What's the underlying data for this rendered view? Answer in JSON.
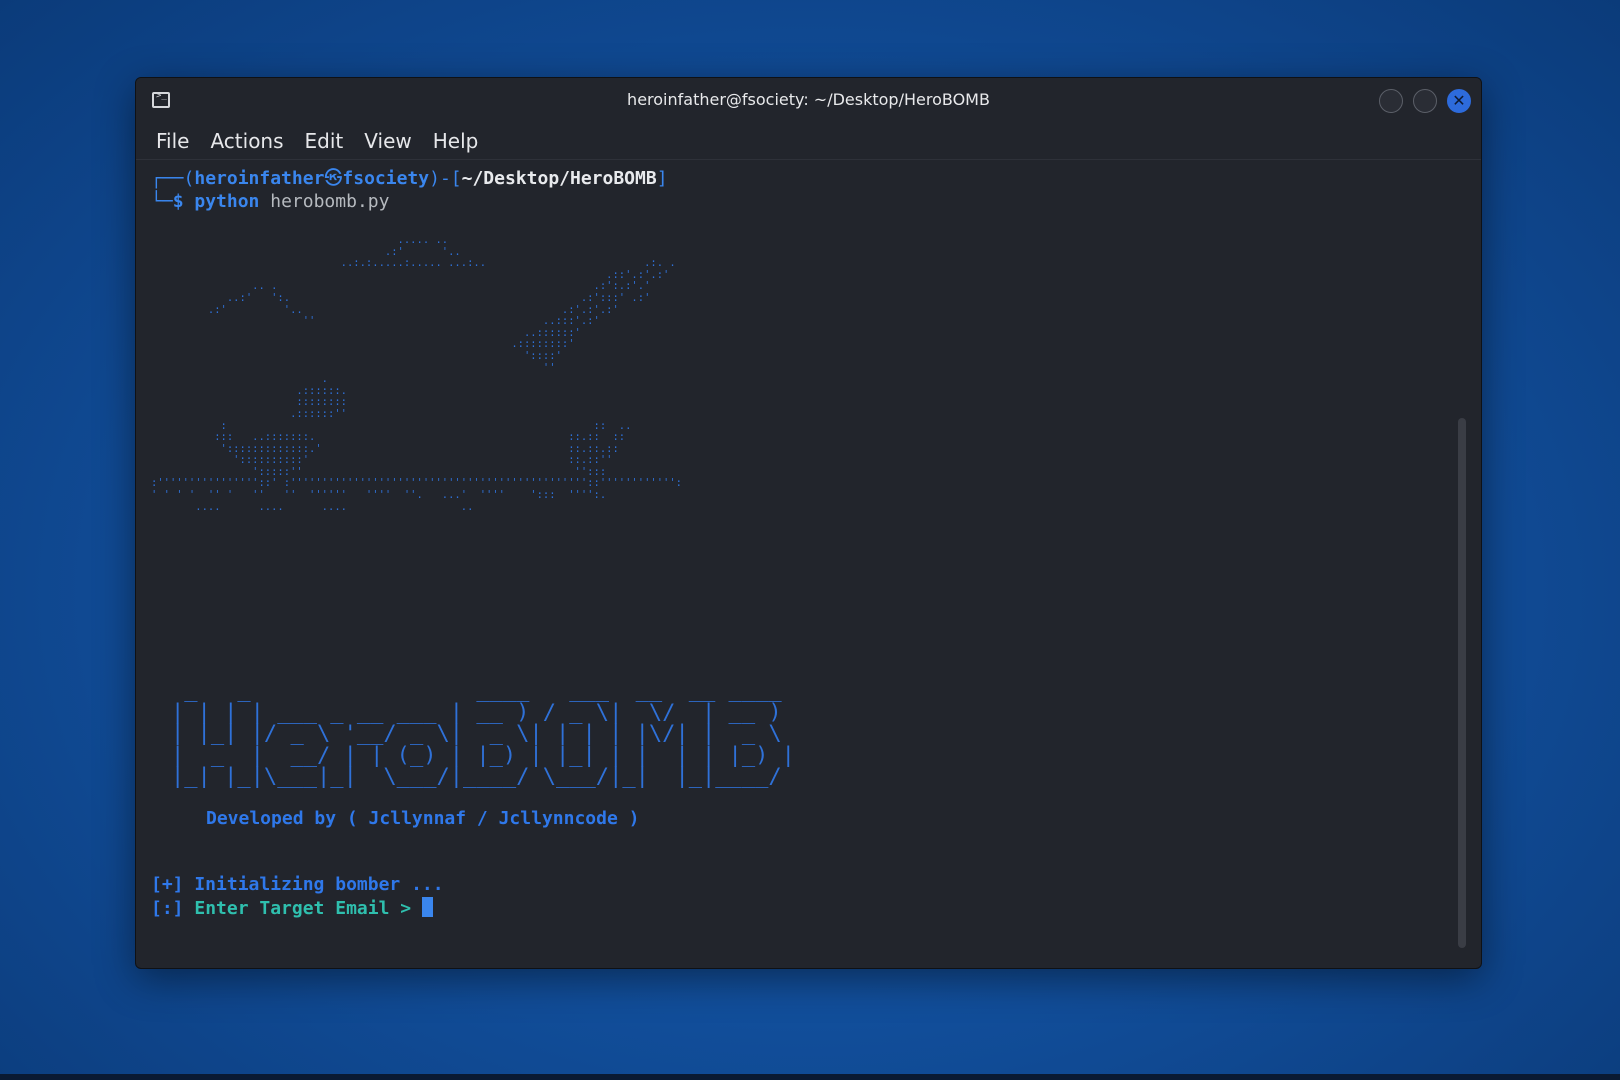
{
  "window": {
    "title": "heroinfather@fsociety: ~/Desktop/HeroBOMB"
  },
  "menu": [
    "File",
    "Actions",
    "Edit",
    "View",
    "Help"
  ],
  "prompt": {
    "frame_top": "┌──(",
    "user": "heroinfather",
    "at_symbol": "㉿",
    "host": "fsociety",
    "mid": ")-[",
    "path": "~/Desktop/HeroBOMB",
    "end": "]",
    "frame_bottom": "└─",
    "dollar": "$",
    "command": "python",
    "argument": "herobomb.py"
  },
  "ascii_art": "                                       ..... ..\n                                     .:'      '..\n                              ..:.:.....:..... ...:..                         .:. .\n                                                                        .::'.:'.:' \n                .. .                                                  .:':.:'.'\n            ..:'   ':.                                              .:':::' .:'\n         .:'         '..                                         .:'.:'.:'\n                        ''                                    ..:::'.:'\n                                                           ..::::::'\n                                                         .::::::::'\n                                                           '::::'\n                                                              ''\n                           .\n                       .::::::.\n                       ::::::::\n                      .::::::''\n           :                                                          ::  ..\n          :::   ..:::::::.                                        ::.::  ::\n           ':::::::::::::.'                                       ::.::.::\n             '::::::::::'                                         ::.::''\n                ':::::''                                           '':::\n:''''''''''''''''::' :'''''''''''''''''''''''''''''''''''''''''''''''::'''''''''''':\n' ' ' '  '' '   ''   ''  ''''''   ''''  ''.   ...'  ''''    ':::  '''':.\n       ....      ....      ....                  ..",
  "logo": " _   _                 ____   ___  __  __ ____  \n| | | | ___ _ __ ___ | __ ) / _ \\|  \\/  | __ ) \n| |_| |/ _ \\ '__/ _ \\|  _ \\| | | | |\\/| |  _ \\ \n|  _  |  __/ | | (_) | |_) | |_| | |  | | |_) |\n|_| |_|\\___|_|  \\___/|____/ \\___/|_|  |_|____/ ",
  "developer_line": "Developed by ( Jcllynnaf / Jcllynncode )",
  "status_init": "[+] Initializing bomber ...",
  "status_prompt_bracket": "[:]",
  "status_prompt_text": " Enter Target Email > "
}
